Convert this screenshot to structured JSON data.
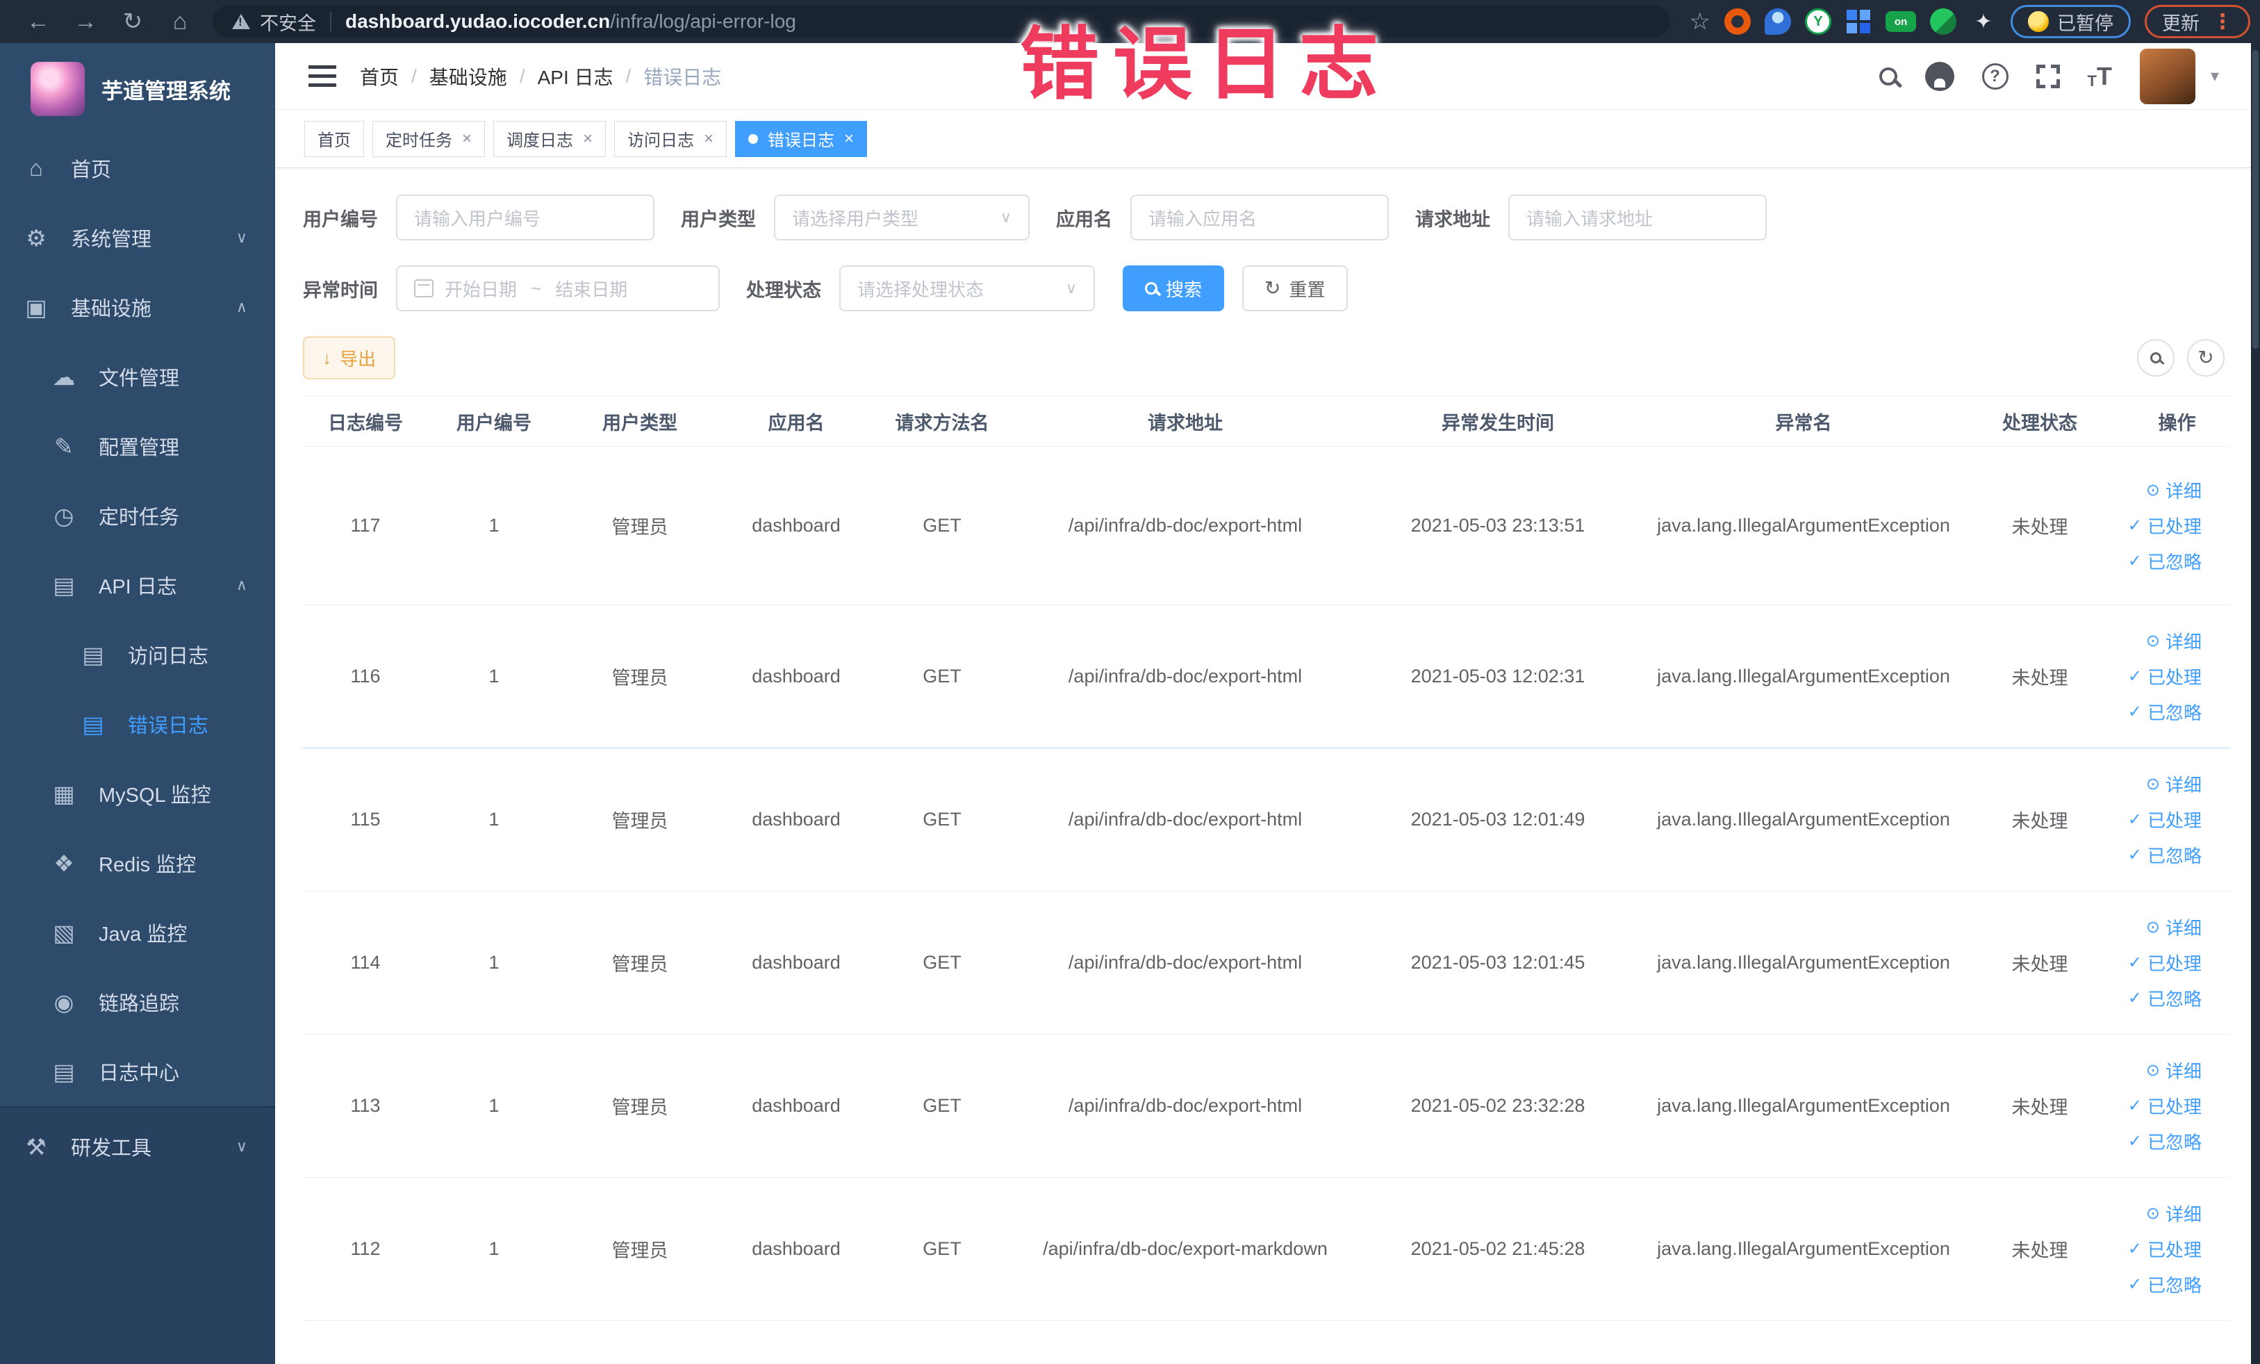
{
  "colors": {
    "accent": "#409eff",
    "warning": "#e6a23c",
    "overlay_red": "#ee3b5e",
    "sidebar_bg": "#2e4b6b"
  },
  "browser": {
    "security_label": "不安全",
    "url_host": "dashboard.yudao.iocoder.cn",
    "url_path": "/infra/log/api-error-log",
    "paused_badge": "已暂停",
    "update_badge": "更新"
  },
  "overlay": {
    "caption": "错误日志"
  },
  "sidebar": {
    "title": "芋道管理系统",
    "items": [
      {
        "key": "home",
        "label": "首页",
        "icon": "home-icon",
        "level": 1
      },
      {
        "key": "system",
        "label": "系统管理",
        "icon": "gear-icon",
        "level": 1,
        "chevron": "down"
      },
      {
        "key": "infra",
        "label": "基础设施",
        "icon": "server-icon",
        "level": 1,
        "chevron": "up"
      },
      {
        "key": "file",
        "label": "文件管理",
        "icon": "cloud-upload-icon",
        "level": 2
      },
      {
        "key": "config",
        "label": "配置管理",
        "icon": "edit-icon",
        "level": 2
      },
      {
        "key": "job",
        "label": "定时任务",
        "icon": "timer-icon",
        "level": 2
      },
      {
        "key": "api-log",
        "label": "API 日志",
        "icon": "log-icon",
        "level": 2,
        "chevron": "up"
      },
      {
        "key": "access-log",
        "label": "访问日志",
        "icon": "log-icon",
        "level": 3
      },
      {
        "key": "error-log",
        "label": "错误日志",
        "icon": "log-icon",
        "level": 3,
        "active": true
      },
      {
        "key": "mysql",
        "label": "MySQL 监控",
        "icon": "mysql-icon",
        "level": 2
      },
      {
        "key": "redis",
        "label": "Redis 监控",
        "icon": "redis-icon",
        "level": 2
      },
      {
        "key": "java",
        "label": "Java 监控",
        "icon": "java-icon",
        "level": 2
      },
      {
        "key": "trace",
        "label": "链路追踪",
        "icon": "trace-eye-icon",
        "level": 2
      },
      {
        "key": "log-center",
        "label": "日志中心",
        "icon": "log-center-icon",
        "level": 2
      },
      {
        "key": "dev-tools",
        "label": "研发工具",
        "icon": "tools-icon",
        "level": 1,
        "chevron": "down",
        "section": "bottom"
      }
    ]
  },
  "breadcrumb": {
    "items": [
      "首页",
      "基础设施",
      "API 日志",
      "错误日志"
    ]
  },
  "tabs": [
    {
      "key": "home",
      "label": "首页",
      "closable": false
    },
    {
      "key": "job",
      "label": "定时任务",
      "closable": true
    },
    {
      "key": "job-log",
      "label": "调度日志",
      "closable": true
    },
    {
      "key": "access-log",
      "label": "访问日志",
      "closable": true
    },
    {
      "key": "error-log",
      "label": "错误日志",
      "closable": true,
      "active": true
    }
  ],
  "filters": {
    "user_id": {
      "label": "用户编号",
      "placeholder": "请输入用户编号"
    },
    "user_type": {
      "label": "用户类型",
      "placeholder": "请选择用户类型"
    },
    "app_name": {
      "label": "应用名",
      "placeholder": "请输入应用名"
    },
    "request_url": {
      "label": "请求地址",
      "placeholder": "请输入请求地址"
    },
    "exception_time": {
      "label": "异常时间",
      "start_placeholder": "开始日期",
      "separator": "~",
      "end_placeholder": "结束日期"
    },
    "handle_status": {
      "label": "处理状态",
      "placeholder": "请选择处理状态"
    },
    "search_label": "搜索",
    "reset_label": "重置"
  },
  "toolbar": {
    "export_label": "导出"
  },
  "table": {
    "headers": [
      "日志编号",
      "用户编号",
      "用户类型",
      "应用名",
      "请求方法名",
      "请求地址",
      "异常发生时间",
      "异常名",
      "处理状态",
      "操作"
    ],
    "actions": [
      {
        "key": "detail",
        "label": "详细"
      },
      {
        "key": "handled",
        "label": "已处理"
      },
      {
        "key": "ignored",
        "label": "已忽略"
      }
    ],
    "rows": [
      {
        "id": "117",
        "user_id": "1",
        "user_type": "管理员",
        "app": "dashboard",
        "method": "GET",
        "url": "/api/infra/db-doc/export-html",
        "time": "2021-05-03 23:13:51",
        "exception": "java.lang.IllegalArgumentException",
        "status": "未处理"
      },
      {
        "id": "116",
        "user_id": "1",
        "user_type": "管理员",
        "app": "dashboard",
        "method": "GET",
        "url": "/api/infra/db-doc/export-html",
        "time": "2021-05-03 12:02:31",
        "exception": "java.lang.IllegalArgumentException",
        "status": "未处理",
        "divider": "blue"
      },
      {
        "id": "115",
        "user_id": "1",
        "user_type": "管理员",
        "app": "dashboard",
        "method": "GET",
        "url": "/api/infra/db-doc/export-html",
        "time": "2021-05-03 12:01:49",
        "exception": "java.lang.IllegalArgumentException",
        "status": "未处理"
      },
      {
        "id": "114",
        "user_id": "1",
        "user_type": "管理员",
        "app": "dashboard",
        "method": "GET",
        "url": "/api/infra/db-doc/export-html",
        "time": "2021-05-03 12:01:45",
        "exception": "java.lang.IllegalArgumentException",
        "status": "未处理"
      },
      {
        "id": "113",
        "user_id": "1",
        "user_type": "管理员",
        "app": "dashboard",
        "method": "GET",
        "url": "/api/infra/db-doc/export-html",
        "time": "2021-05-02 23:32:28",
        "exception": "java.lang.IllegalArgumentException",
        "status": "未处理"
      },
      {
        "id": "112",
        "user_id": "1",
        "user_type": "管理员",
        "app": "dashboard",
        "method": "GET",
        "url": "/api/infra/db-doc/export-markdown",
        "time": "2021-05-02 21:45:28",
        "exception": "java.lang.IllegalArgumentException",
        "status": "未处理"
      }
    ]
  }
}
